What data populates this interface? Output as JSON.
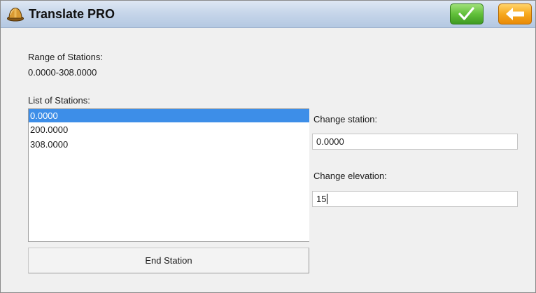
{
  "window": {
    "title": "Translate PRO",
    "app_icon": "hard-hat-icon",
    "accept_icon": "checkmark-icon",
    "back_icon": "arrow-left-icon"
  },
  "range": {
    "label": "Range of Stations:",
    "value": "0.0000-308.0000"
  },
  "stations": {
    "label": "List of Stations:",
    "items": [
      "0.0000",
      "200.0000",
      "308.0000"
    ],
    "selected_index": 0
  },
  "change_station": {
    "label": "Change station:",
    "value": "0.0000"
  },
  "change_elevation": {
    "label": "Change elevation:",
    "value": "15"
  },
  "end_station_button": {
    "label": "End Station"
  },
  "colors": {
    "selection": "#3d8ee8",
    "accept_button": "#62c03a",
    "back_button": "#f7a81d"
  }
}
